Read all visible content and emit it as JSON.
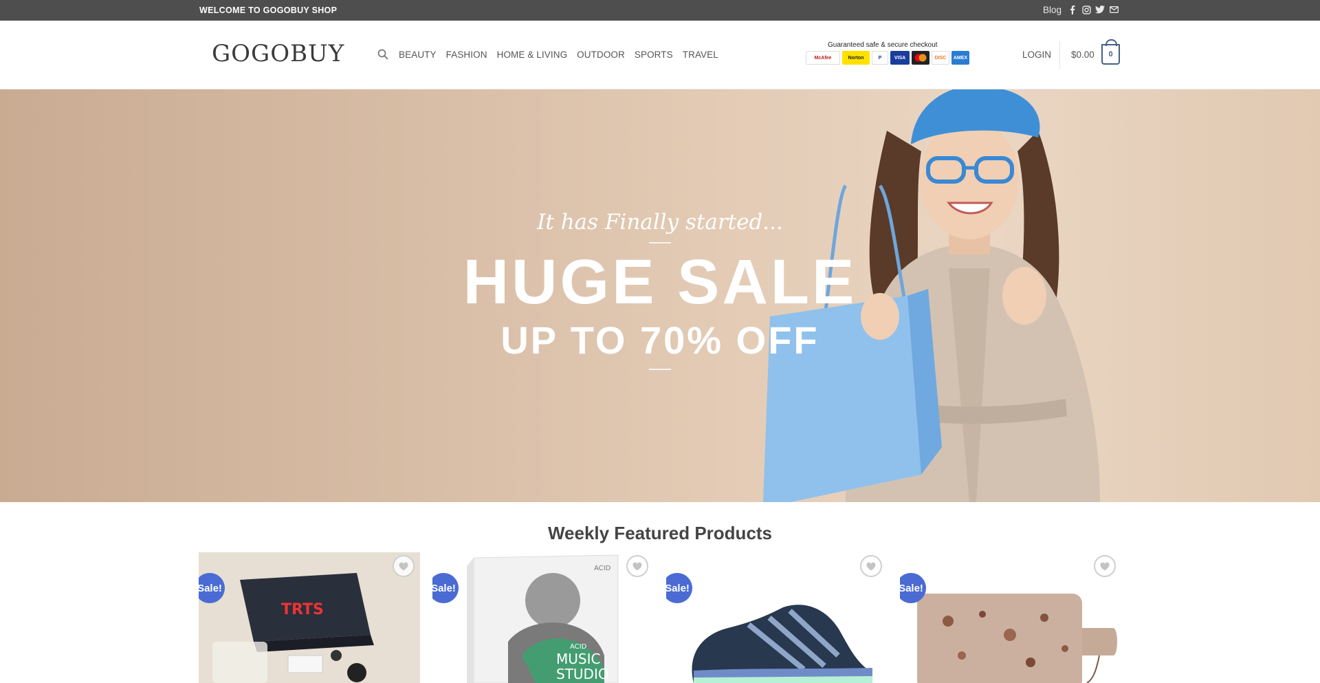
{
  "topbar": {
    "welcome": "WELCOME TO GOGOBUY SHOP",
    "blog": "Blog",
    "social": [
      "facebook-icon",
      "instagram-icon",
      "twitter-icon",
      "email-icon"
    ]
  },
  "header": {
    "logo": "GOGOBUY",
    "nav": [
      "BEAUTY",
      "FASHION",
      "HOME & LIVING",
      "OUTDOOR",
      "SPORTS",
      "TRAVEL"
    ],
    "trust_caption": "Guaranteed safe & secure checkout",
    "trust_badges": [
      "McAfee SECURE",
      "Norton",
      "PayPal",
      "VISA",
      "Mastercard",
      "Discover",
      "American Express"
    ],
    "login": "LOGIN",
    "cart_total": "$0.00",
    "cart_count": "0"
  },
  "hero": {
    "tagline": "It has Finally started...",
    "headline": "HUGE SALE",
    "subheadline": "UP TO 70% OFF"
  },
  "featured": {
    "title": "Weekly Featured Products",
    "products": [
      {
        "badge": "Sale!",
        "image": "rc-car-kit-box"
      },
      {
        "badge": "Sale!",
        "image": "music-studio-software-box"
      },
      {
        "badge": "Sale!",
        "image": "running-shoe"
      },
      {
        "badge": "Sale!",
        "image": "terrazzo-cutting-board"
      }
    ]
  },
  "colors": {
    "topbar": "#4e4e4e",
    "primary": "#446084",
    "sale_badge": "#4a6bd4"
  }
}
